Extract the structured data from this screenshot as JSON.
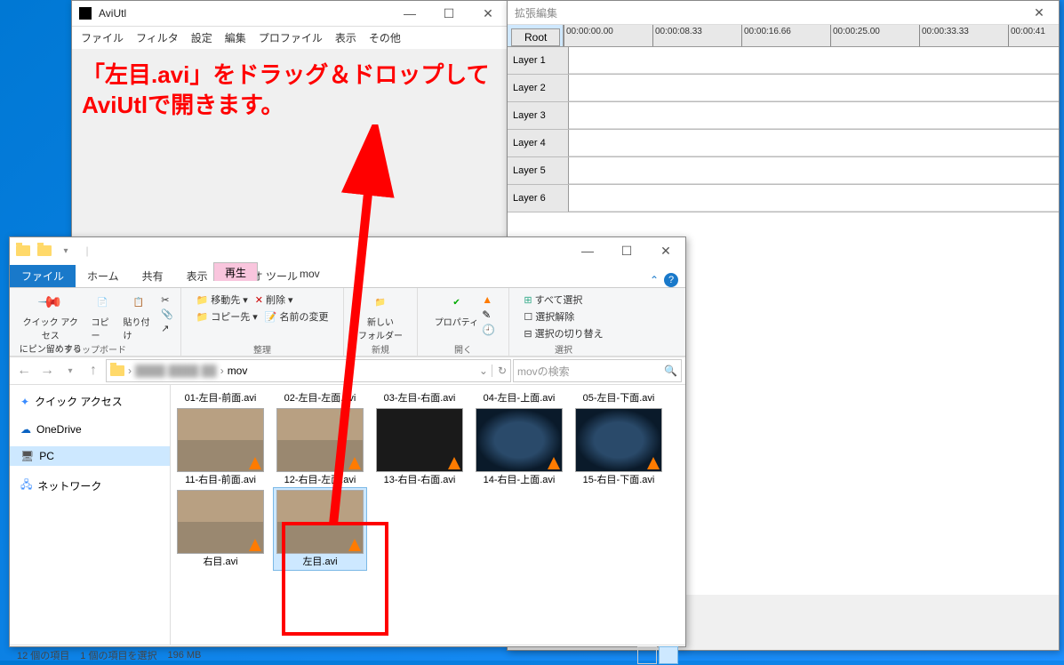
{
  "aviutl": {
    "title": "AviUtl",
    "menu": [
      "ファイル",
      "フィルタ",
      "設定",
      "編集",
      "プロファイル",
      "表示",
      "その他"
    ]
  },
  "ext": {
    "title": "拡張編集",
    "root": "Root",
    "ticks": [
      "00:00:00.00",
      "00:00:08.33",
      "00:00:16.66",
      "00:00:25.00",
      "00:00:33.33",
      "00:00:41"
    ],
    "layers": [
      "Layer 1",
      "Layer 2",
      "Layer 3",
      "Layer 4",
      "Layer 5",
      "Layer 6"
    ]
  },
  "explorer": {
    "playback_tab": "再生",
    "folder_label": "mov",
    "tabs": {
      "file": "ファイル",
      "home": "ホーム",
      "share": "共有",
      "view": "表示",
      "video": "ビデオ ツール"
    },
    "ribbon": {
      "clipboard": {
        "label": "クリップボード",
        "pin": "クイック アクセス\nにピン留めする",
        "copy": "コピー",
        "paste": "貼り付け"
      },
      "organize": {
        "label": "整理",
        "moveto": "移動先",
        "copyto": "コピー先",
        "delete": "削除",
        "rename": "名前の変更"
      },
      "new": {
        "label": "新規",
        "newfolder": "新しい\nフォルダー"
      },
      "open": {
        "label": "開く",
        "properties": "プロパティ"
      },
      "select": {
        "label": "選択",
        "all": "すべて選択",
        "none": "選択解除",
        "invert": "選択の切り替え"
      }
    },
    "addr_folder": "mov",
    "search_placeholder": "movの検索",
    "nav": {
      "quick": "クイック アクセス",
      "onedrive": "OneDrive",
      "pc": "PC",
      "network": "ネットワーク"
    },
    "files_row1": [
      "01-左目-前面.avi",
      "02-左目-左面.avi",
      "03-左目-右面.avi",
      "04-左目-上面.avi",
      "05-左目-下面.avi"
    ],
    "files_row2": [
      "11-右目-前面.avi",
      "12-右目-左面.avi",
      "13-右目-右面.avi",
      "14-右目-上面.avi",
      "15-右目-下面.avi"
    ],
    "files_row3": [
      "右目.avi",
      "左目.avi"
    ],
    "status": {
      "items": "12 個の項目",
      "selected": "1 個の項目を選択",
      "size": "196 MB"
    }
  },
  "annotation": {
    "line1": "「左目.avi」をドラッグ＆ドロップして",
    "line2": "AviUtlで開きます。"
  }
}
